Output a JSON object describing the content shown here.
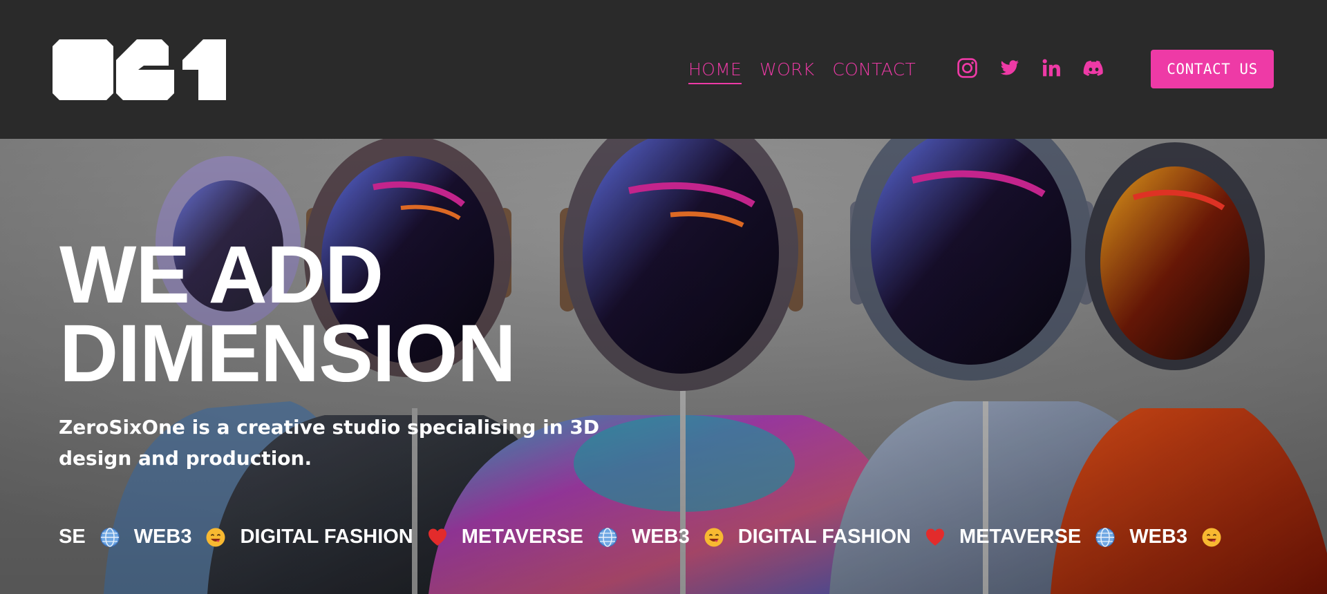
{
  "brand": {
    "logo_alt": "061",
    "logo_icon": "zerosixone-logo"
  },
  "nav": {
    "items": [
      {
        "label": "HOME",
        "active": true
      },
      {
        "label": "WORK",
        "active": false
      },
      {
        "label": "CONTACT",
        "active": false
      }
    ]
  },
  "socials": [
    {
      "icon": "instagram-icon"
    },
    {
      "icon": "twitter-icon"
    },
    {
      "icon": "linkedin-icon"
    },
    {
      "icon": "discord-icon"
    }
  ],
  "header": {
    "cta_label": "CONTACT US"
  },
  "hero": {
    "headline_line1": "WE ADD",
    "headline_line2": "DIMENSION",
    "tagline": "ZeroSixOne is a creative studio specialising in 3D design and production.",
    "background_image": "3D avatars wearing helmets and puffer jackets"
  },
  "ticker": {
    "words": [
      "SE",
      "WEB3",
      "DIGITAL FASHION",
      "METAVERSE",
      "WEB3",
      "DIGITAL FASHION",
      "METAVERSE",
      "WEB3"
    ],
    "glyphs": [
      "globe-icon",
      "smiling-face-icon",
      "heart-icon",
      "globe-icon",
      "smiling-face-icon",
      "heart-icon",
      "globe-icon",
      "smiling-face-icon"
    ]
  },
  "colors": {
    "accent": "#ee3aa6",
    "header_bg": "#2a2a2a",
    "text_light": "#ffffff"
  }
}
